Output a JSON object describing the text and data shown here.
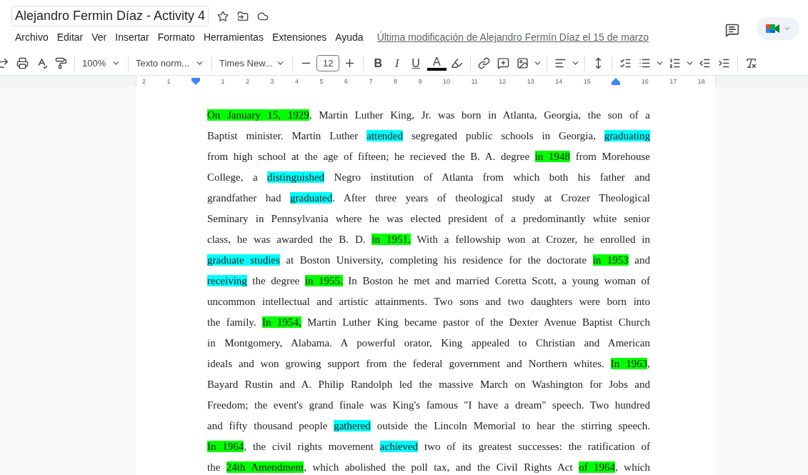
{
  "title": "Alejandro Fermin Díaz - Activity 4",
  "menu": [
    "Archivo",
    "Editar",
    "Ver",
    "Insertar",
    "Formato",
    "Herramientas",
    "Extensiones",
    "Ayuda"
  ],
  "last_edit": "Última modificación de Alejandro Fermín Díaz el 15 de marzo",
  "toolbar": {
    "zoom": "100%",
    "style": "Texto norm...",
    "font": "Times New...",
    "font_size": "12",
    "bold": "B",
    "italic": "I",
    "underline": "U",
    "text_color": "A"
  },
  "ruler": [
    "2",
    "1",
    "1",
    "2",
    "3",
    "4",
    "5",
    "6",
    "7",
    "8",
    "9",
    "10",
    "11",
    "12",
    "13",
    "14",
    "15",
    "16",
    "17",
    "18"
  ],
  "document": {
    "lines": [
      [
        {
          "text": "On January 15, 1929",
          "color": "#00ff00"
        },
        {
          "text": ", Martin Luther King, Jr. was born in Atlanta, Georgia, the son of a"
        }
      ],
      [
        {
          "text": "Baptist minister. Martin Luther "
        },
        {
          "text": "attended",
          "color": "#00ffff"
        },
        {
          "text": " segregated public schools in Georgia, "
        },
        {
          "text": "graduating",
          "color": "#00ffff"
        }
      ],
      [
        {
          "text": "from high school at the age of fifteen; he recieved the B. A. degree "
        },
        {
          "text": "in 1948",
          "color": "#00ff00"
        },
        {
          "text": " from Morehouse"
        }
      ],
      [
        {
          "text": "College, a "
        },
        {
          "text": "distinguished",
          "color": "#00ffff"
        },
        {
          "text": " Negro institution of Atlanta from which both his father and"
        }
      ],
      [
        {
          "text": "grandfather had "
        },
        {
          "text": "graduated",
          "color": "#00ffff"
        },
        {
          "text": ". After three years of theological study at Crozer Theological"
        }
      ],
      [
        {
          "text": "Seminary in Pennsylvania where he was elected president of a predominantly white senior"
        }
      ],
      [
        {
          "text": "class, he was awarded the B. D. "
        },
        {
          "text": "in 1951.",
          "color": "#00ff00"
        },
        {
          "text": " With a fellowship won at Crozer, he enrolled in"
        }
      ],
      [
        {
          "text": "graduate studies",
          "color": "#00ffff"
        },
        {
          "text": " at Boston University, completing his residence for the doctorate "
        },
        {
          "text": "in 1953",
          "color": "#00ff00"
        },
        {
          "text": " and"
        }
      ],
      [
        {
          "text": "receiving",
          "color": "#00ffff"
        },
        {
          "text": " the degree "
        },
        {
          "text": "in 1955.",
          "color": "#00ff00"
        },
        {
          "text": " In Boston he met and married Coretta Scott, a young woman of"
        }
      ],
      [
        {
          "text": "uncommon intellectual and artistic attainments. Two sons and two daughters were born into"
        }
      ],
      [
        {
          "text": "the family. "
        },
        {
          "text": "In 1954,",
          "color": "#00ff00"
        },
        {
          "text": " Martin Luther King became pastor of the Dexter Avenue Baptist Church"
        }
      ],
      [
        {
          "text": "in Montgomery, Alabama. A powerful orator, King appealed to Christian and American"
        }
      ],
      [
        {
          "text": "ideals and won growing support from the federal government and Northern whites. "
        },
        {
          "text": "In 1963",
          "color": "#00ff00"
        },
        {
          "text": ","
        }
      ],
      [
        {
          "text": "Bayard Rustin and A. Philip Randolph led the massive March on Washington for Jobs and"
        }
      ],
      [
        {
          "text": "Freedom; the event's grand finale was King's famous \"I have a dream\" speech. Two hundred"
        }
      ],
      [
        {
          "text": "and fifty thousand people "
        },
        {
          "text": "gathered",
          "color": "#00ffff"
        },
        {
          "text": " outside the Lincoln Memorial to hear the stirring speech."
        }
      ],
      [
        {
          "text": "In 1964",
          "color": "#00ff00"
        },
        {
          "text": ", the civil rights movement "
        },
        {
          "text": "achieved",
          "color": "#00ffff"
        },
        {
          "text": " two of its greatest successes: the ratification of"
        }
      ],
      [
        {
          "text": "the "
        },
        {
          "text": "24th Amendment",
          "color": "#00ff00"
        },
        {
          "text": ", which abolished the poll tax, and the Civil Rights Act "
        },
        {
          "text": "of 1964",
          "color": "#00ff00"
        },
        {
          "text": ", which"
        }
      ]
    ]
  }
}
